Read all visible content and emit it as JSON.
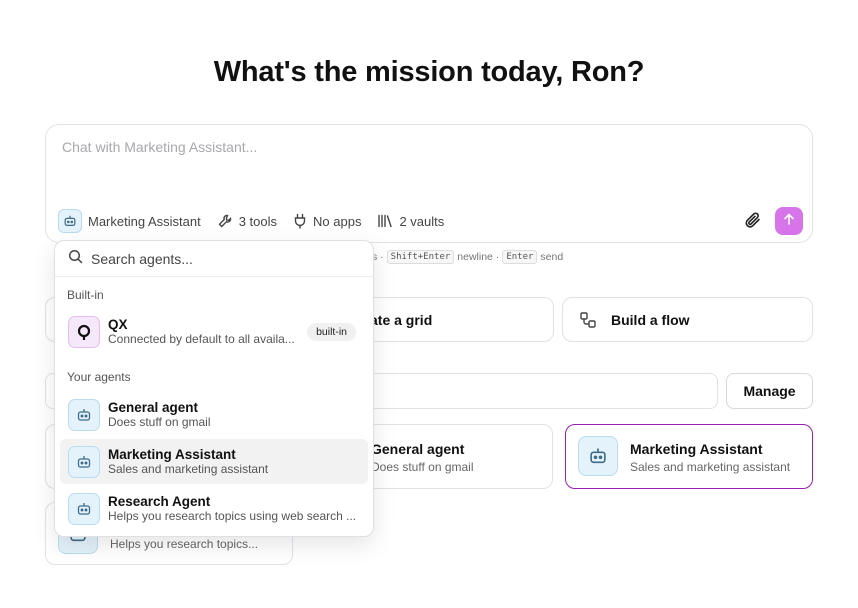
{
  "heading": "What's the mission today, Ron?",
  "composer": {
    "placeholder": "Chat with Marketing Assistant...",
    "agent_label": "Marketing Assistant",
    "tools_label": "3 tools",
    "apps_label": "No apps",
    "vaults_label": "2 vaults"
  },
  "hint": {
    "prefix": "s ·",
    "newline_key": "Shift+Enter",
    "newline_label": "newline ·",
    "send_key": "Enter",
    "send_label": "send"
  },
  "quick_actions": {
    "grid_label": "ate a grid",
    "flow_label": "Build a flow"
  },
  "manage_label": "Manage",
  "agent_cards": [
    {
      "name": "General agent",
      "desc": "Does stuff on gmail"
    },
    {
      "name": "Marketing Assistant",
      "desc": "Sales and marketing assistant"
    },
    {
      "name": "",
      "desc": "Helps you research topics..."
    }
  ],
  "dropdown": {
    "search_placeholder": "Search agents...",
    "builtin_heading": "Built-in",
    "builtin": {
      "name": "QX",
      "desc": "Connected by default to all availa...",
      "badge": "built-in"
    },
    "yours_heading": "Your agents",
    "agents": [
      {
        "name": "General agent",
        "desc": "Does stuff on gmail"
      },
      {
        "name": "Marketing Assistant",
        "desc": "Sales and marketing assistant"
      },
      {
        "name": "Research Agent",
        "desc": "Helps you research topics using web search ..."
      }
    ]
  },
  "colors": {
    "accent": "#d774ea",
    "selected_border": "#9b1fb0",
    "agent_icon_bg": "#e4f2fb"
  }
}
